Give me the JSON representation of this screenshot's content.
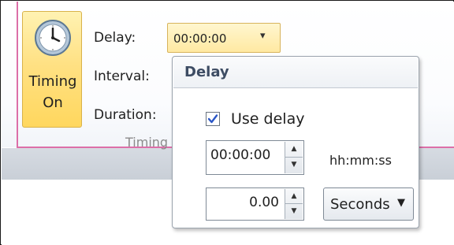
{
  "timing_button": {
    "label_line1": "Timing",
    "label_line2": "On",
    "icon": "clock-icon"
  },
  "fields": {
    "delay_label": "Delay:",
    "interval_label": "Interval:",
    "duration_label": "Duration:"
  },
  "delay_dropdown": {
    "value": "00:00:00",
    "arrow": "▾"
  },
  "group_label": "Timing",
  "popup": {
    "title": "Delay",
    "use_delay_label": "Use delay",
    "use_delay_checked": true,
    "time_value": "00:00:00",
    "time_format": "hh:mm:ss",
    "number_value": "0.00",
    "unit": "Seconds",
    "spin_up": "▲",
    "spin_down": "▼",
    "unit_arrow": "▼"
  },
  "colors": {
    "accent_pink": "#dc6fa8",
    "button_gold": "#ffd75e",
    "header_text": "#3d4c63",
    "check_blue": "#2a56c6"
  }
}
